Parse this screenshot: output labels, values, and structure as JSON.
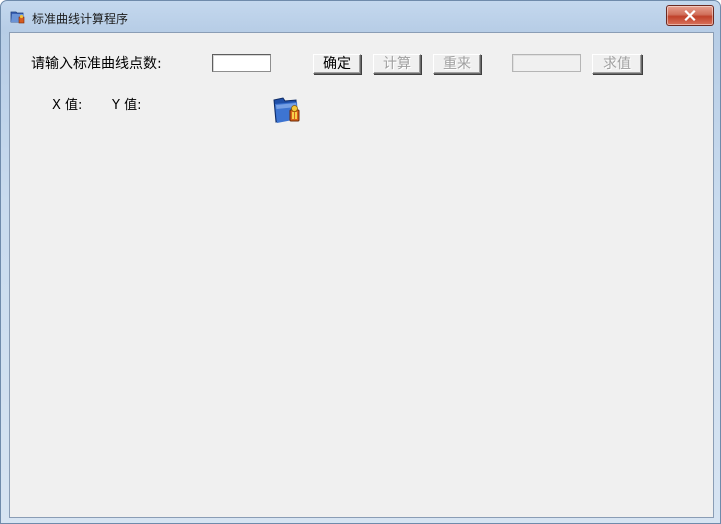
{
  "window": {
    "title": "标准曲线计算程序",
    "close_symbol": "×"
  },
  "form": {
    "prompt_label": "请输入标准曲线点数:",
    "point_count_value": "",
    "confirm_label": "确定",
    "calculate_label": "计算",
    "reset_label": "重来",
    "result_value": "",
    "solve_label": "求值",
    "x_label": "X 值:",
    "y_label": "Y 值:"
  },
  "icons": {
    "app": "app-folder-icon",
    "folder": "folder-icon"
  },
  "colors": {
    "client_bg": "#f0f0f0",
    "frame": "#b7cde6",
    "close": "#c0412a"
  }
}
